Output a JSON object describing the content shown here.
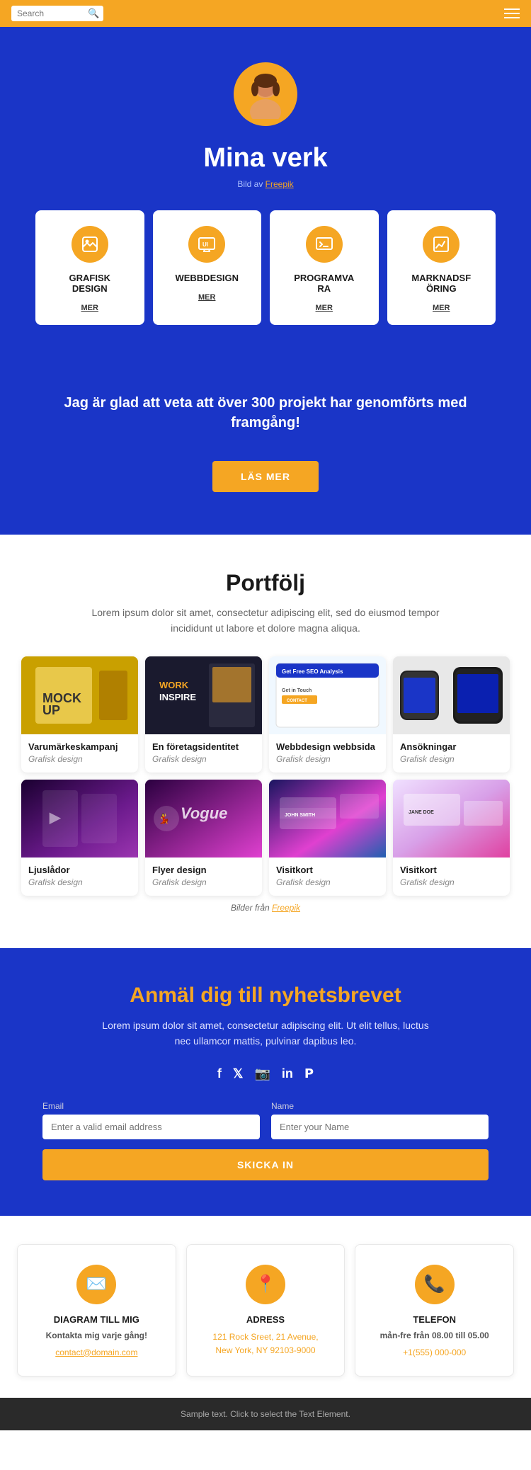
{
  "header": {
    "search_placeholder": "Search",
    "search_icon": "🔍"
  },
  "hero": {
    "title": "Mina verk",
    "bild_prefix": "Bild av ",
    "bild_link": "Freepik"
  },
  "services": [
    {
      "id": "grafisk",
      "icon": "🖼️",
      "title": "GRAFISK\nDESIGN",
      "mer": "MER"
    },
    {
      "id": "webb",
      "icon": "🖥️",
      "title": "WEBBDESIGN",
      "mer": "MER"
    },
    {
      "id": "program",
      "icon": "💻",
      "title": "PROGRAMVA\nRA",
      "mer": "MER"
    },
    {
      "id": "marknad",
      "icon": "📊",
      "title": "MARKNADSF\nÖRING",
      "mer": "MER"
    }
  ],
  "promo": {
    "text": "Jag är glad att veta att över 300 projekt\nhar genomförts med framgång!",
    "button": "LÄS MER"
  },
  "portfolio": {
    "title": "Portfölj",
    "description": "Lorem ipsum dolor sit amet, consectetur adipiscing elit, sed do eiusmod tempor incididunt ut labore et dolore magna aliqua.",
    "bilder_text": "Bilder från Freepik",
    "items": [
      {
        "id": 1,
        "title": "Varumärkeskampanj",
        "category": "Grafisk design",
        "img_class": "portfolio-img-1"
      },
      {
        "id": 2,
        "title": "En företagsidentitet",
        "category": "Grafisk design",
        "img_class": "portfolio-img-2"
      },
      {
        "id": 3,
        "title": "Webbdesign webbsida",
        "category": "Grafisk design",
        "img_class": "portfolio-img-3"
      },
      {
        "id": 4,
        "title": "Ansökningar",
        "category": "Grafisk design",
        "img_class": "portfolio-img-4"
      },
      {
        "id": 5,
        "title": "Ljuslådor",
        "category": "Grafisk design",
        "img_class": "portfolio-img-5"
      },
      {
        "id": 6,
        "title": "Flyer design",
        "category": "Grafisk design",
        "img_class": "portfolio-img-6"
      },
      {
        "id": 7,
        "title": "Visitkort",
        "category": "Grafisk design",
        "img_class": "portfolio-img-7"
      },
      {
        "id": 8,
        "title": "Visitkort",
        "category": "Grafisk design",
        "img_class": "portfolio-img-8"
      }
    ]
  },
  "newsletter": {
    "title": "Anmäl dig till nyhetsbrevet",
    "description": "Lorem ipsum dolor sit amet, consectetur adipiscing elit. Ut elit tellus, luctus nec ullamcor mattis, pulvinar dapibus leo.",
    "email_label": "Email",
    "email_placeholder": "Enter a valid email address",
    "name_label": "Name",
    "name_placeholder": "Enter your Name",
    "button": "SKICKA IN",
    "social": [
      "f",
      "𝕏",
      "in",
      "in",
      "𝗣"
    ]
  },
  "contact": {
    "cards": [
      {
        "id": "email",
        "icon": "✉️",
        "title": "DIAGRAM TILL MIG",
        "sub": "Kontakta mig varje gång!",
        "link": "contact@domain.com"
      },
      {
        "id": "address",
        "icon": "📍",
        "title": "ADRESS",
        "address1": "121 Rock Sreet, 21 Avenue,",
        "address2": "New York, NY 92103-9000"
      },
      {
        "id": "phone",
        "icon": "📞",
        "title": "TELEFON",
        "sub": "mån-fre från 08.00 till 05.00",
        "phone": "+1(555) 000-000"
      }
    ]
  },
  "footer": {
    "text": "Sample text. Click to select the Text Element."
  }
}
